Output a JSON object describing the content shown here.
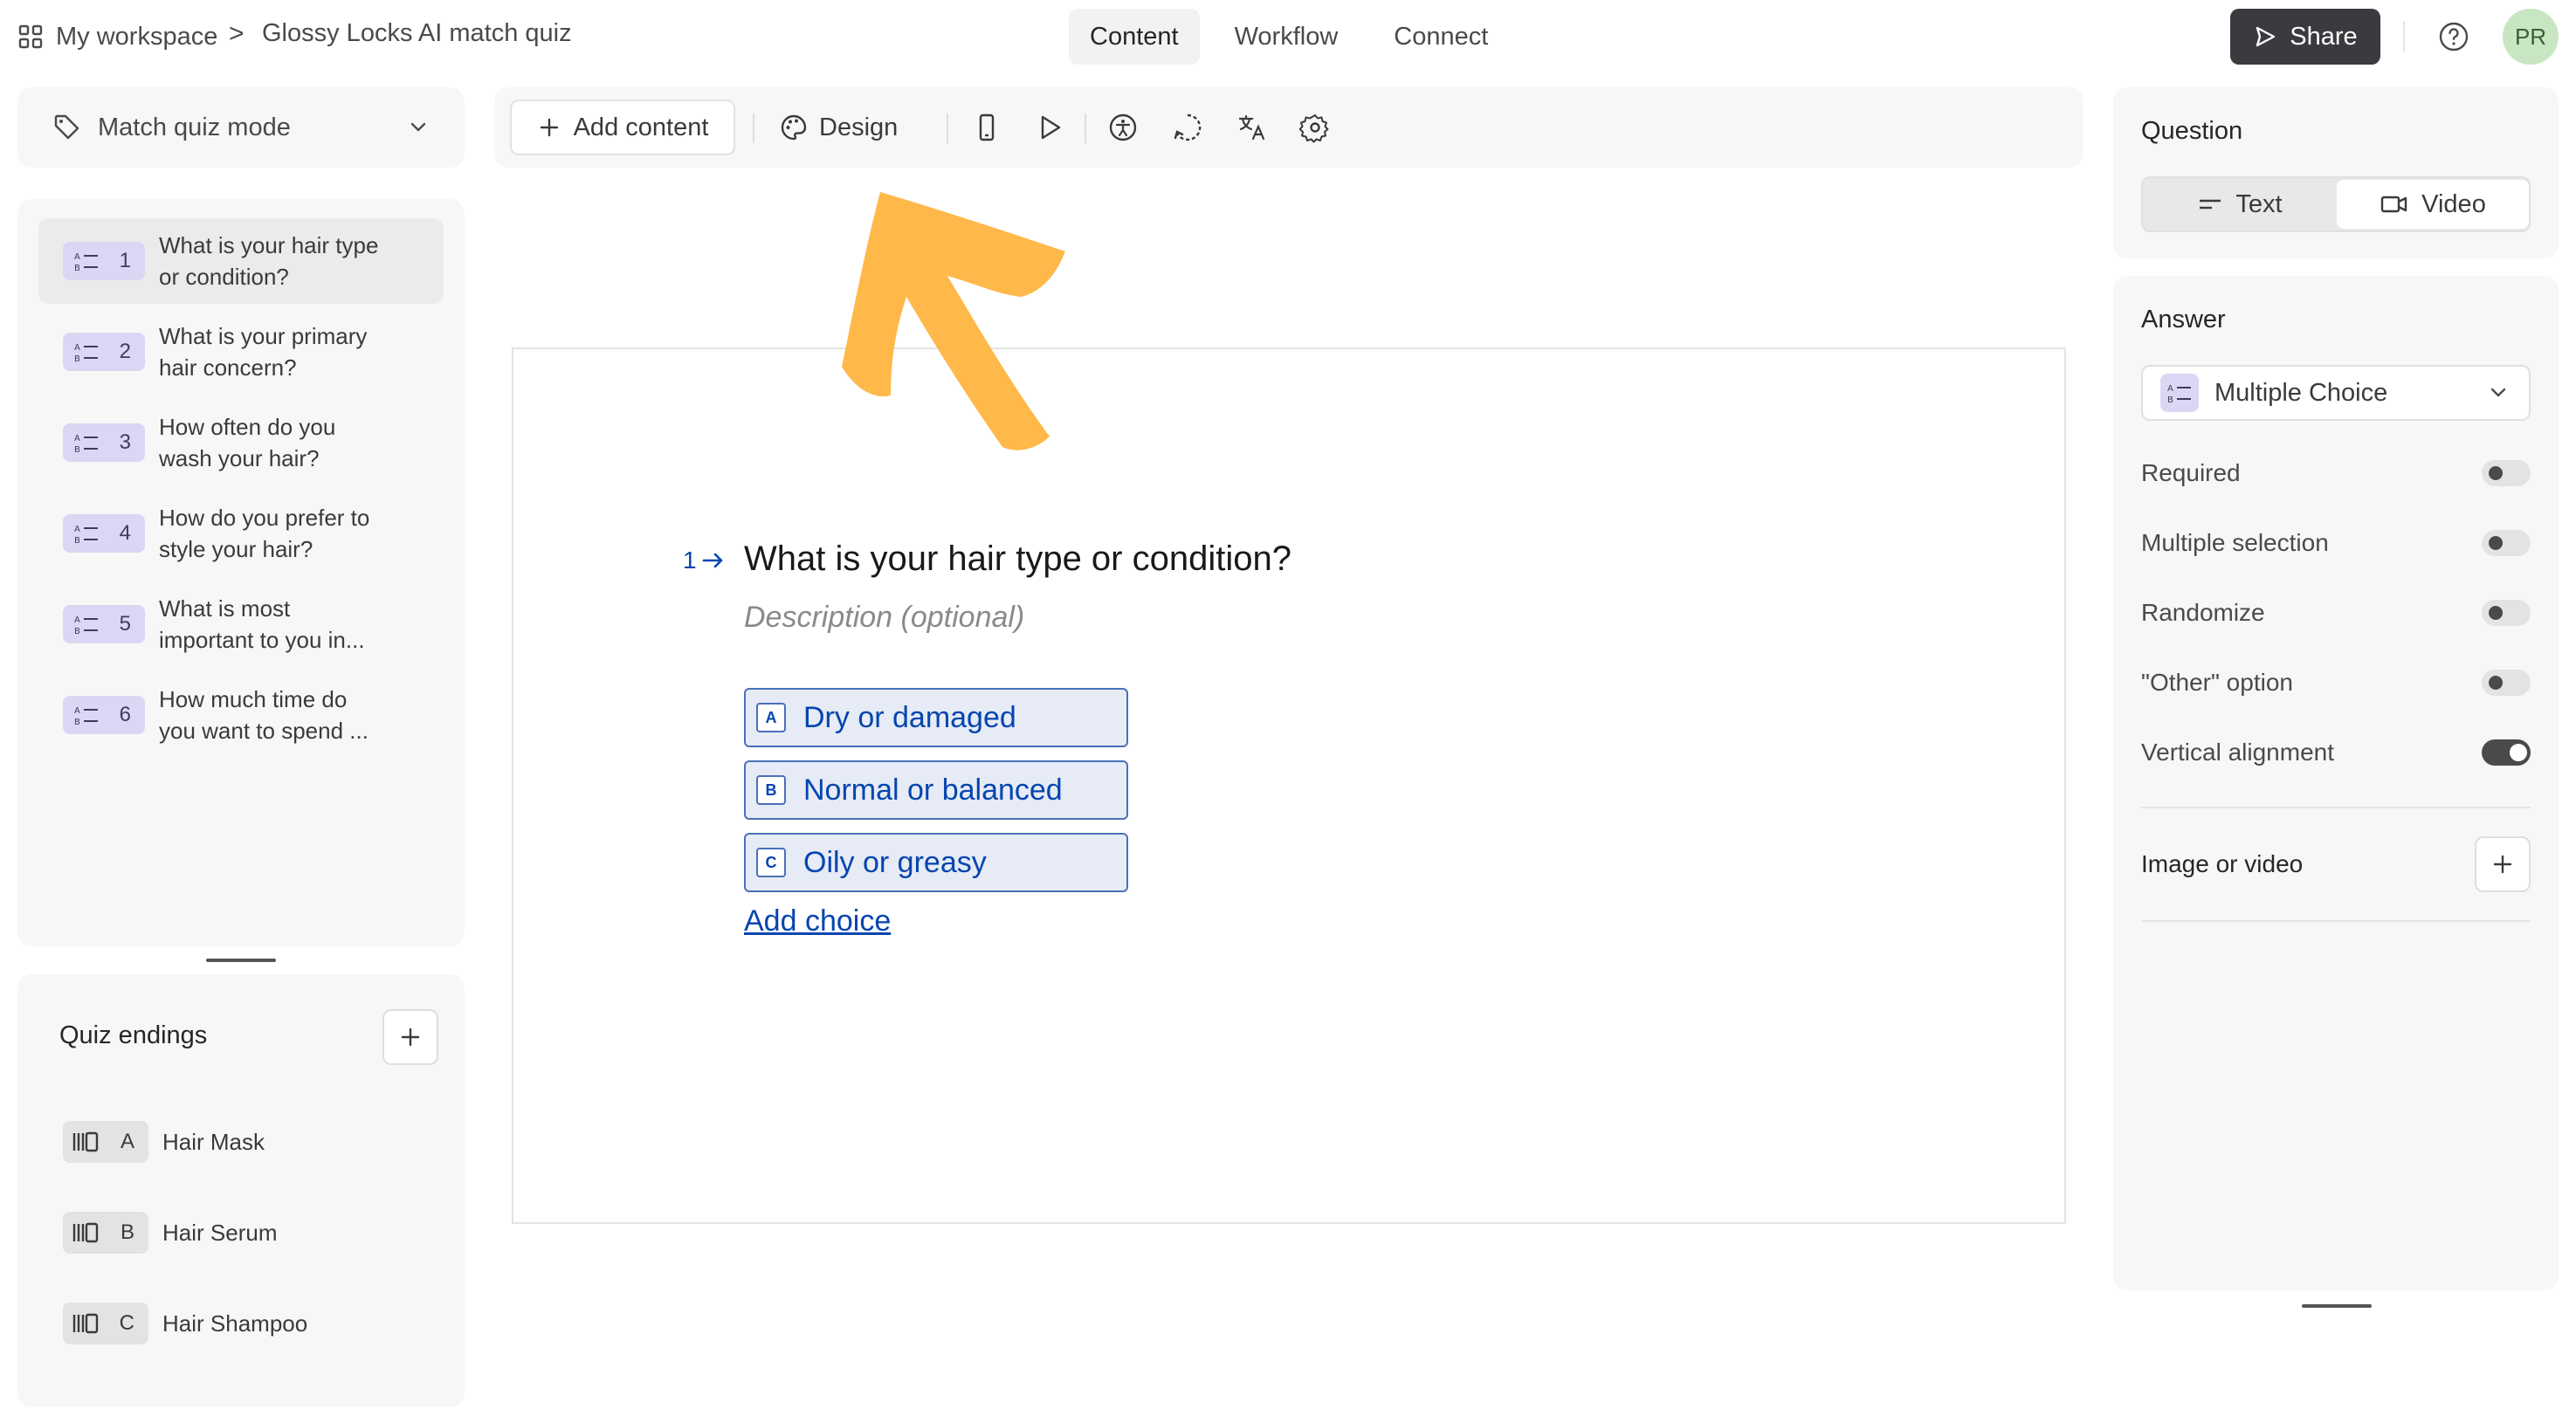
{
  "breadcrumb": {
    "workspace": "My workspace",
    "separator": ">",
    "form_title": "Glossy Locks AI match quiz"
  },
  "header_tabs": [
    {
      "label": "Content",
      "active": true
    },
    {
      "label": "Workflow",
      "active": false
    },
    {
      "label": "Connect",
      "active": false
    }
  ],
  "share": {
    "label": "Share"
  },
  "user": {
    "initials": "PR"
  },
  "mode": {
    "label": "Match quiz mode"
  },
  "questions": [
    {
      "number": "1",
      "text": "What is your hair type or condition?",
      "active": true
    },
    {
      "number": "2",
      "text": "What is your primary hair concern?",
      "active": false
    },
    {
      "number": "3",
      "text": "How often do you wash your hair?",
      "active": false
    },
    {
      "number": "4",
      "text": "How do you prefer to style your hair?",
      "active": false
    },
    {
      "number": "5",
      "text": "What is most important to you in...",
      "active": false
    },
    {
      "number": "6",
      "text": "How much time do you want to spend ...",
      "active": false
    }
  ],
  "endings": {
    "title": "Quiz endings",
    "items": [
      {
        "key": "A",
        "label": "Hair Mask"
      },
      {
        "key": "B",
        "label": "Hair Serum"
      },
      {
        "key": "C",
        "label": "Hair Shampoo"
      }
    ]
  },
  "toolbar": {
    "add_content": "Add content",
    "design": "Design"
  },
  "editor": {
    "number": "1",
    "title": "What is your hair type or condition?",
    "description_placeholder": "Description (optional)",
    "choices": [
      {
        "key": "A",
        "label": "Dry or damaged"
      },
      {
        "key": "B",
        "label": "Normal or balanced"
      },
      {
        "key": "C",
        "label": "Oily or greasy"
      }
    ],
    "add_choice": "Add choice"
  },
  "question_settings": {
    "title": "Question",
    "formats": [
      {
        "label": "Text",
        "selected": true
      },
      {
        "label": "Video",
        "selected": false
      }
    ]
  },
  "answer_settings": {
    "title": "Answer",
    "type": "Multiple Choice",
    "toggles": [
      {
        "label": "Required",
        "on": false
      },
      {
        "label": "Multiple selection",
        "on": false
      },
      {
        "label": "Randomize",
        "on": false
      },
      {
        "label": "\"Other\" option",
        "on": false
      },
      {
        "label": "Vertical alignment",
        "on": true
      }
    ],
    "media_label": "Image or video"
  },
  "colors": {
    "accent": "#0445af",
    "annotation_arrow": "#ffb84a",
    "share_button": "#3c3a3e",
    "avatar_bg": "#c8e6c1",
    "question_badge": "#dcd6f5"
  }
}
